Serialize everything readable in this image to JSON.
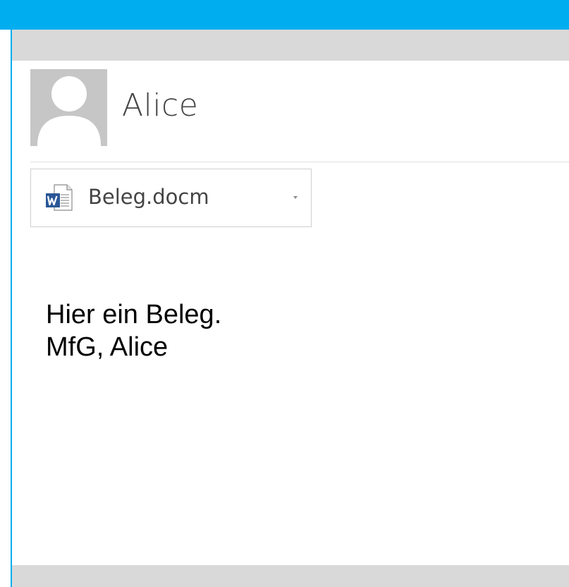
{
  "colors": {
    "accent": "#00adef",
    "bar_gray": "#d9d9d9",
    "avatar_bg": "#c6c6c6",
    "word_blue": "#2b5797"
  },
  "message": {
    "sender": {
      "name": "Alice",
      "avatar_icon": "person-silhouette-icon"
    },
    "attachment": {
      "filename": "Beleg.docm",
      "icon": "word-document-icon",
      "menu_icon": "chevron-down-icon"
    },
    "body_lines": [
      "Hier ein Beleg.",
      "MfG, Alice"
    ]
  }
}
